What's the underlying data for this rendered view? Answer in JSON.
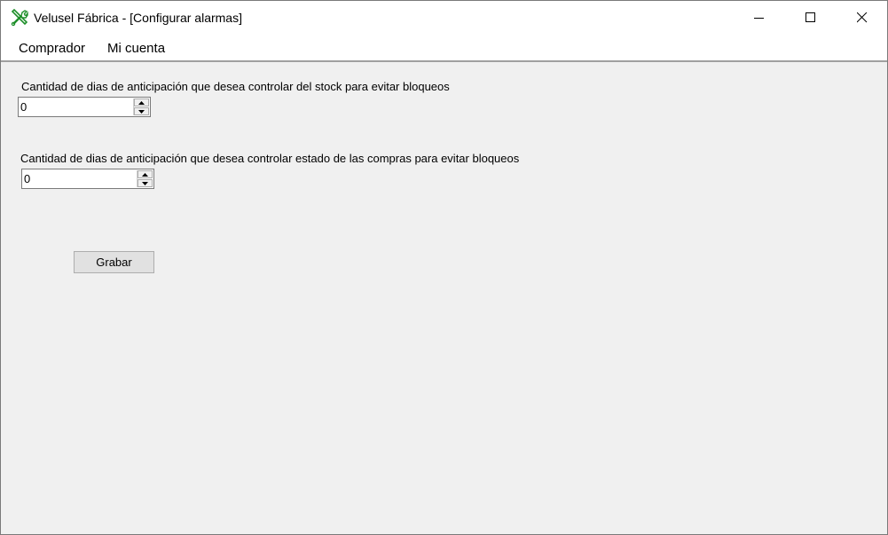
{
  "window": {
    "title": "Velusel Fábrica - [Configurar alarmas]",
    "icon": "tools-icon",
    "controls": [
      "minimize-icon",
      "maximize-icon",
      "close-icon"
    ]
  },
  "menu": {
    "items": [
      {
        "label": "Comprador"
      },
      {
        "label": "Mi cuenta"
      }
    ]
  },
  "form": {
    "stock_days": {
      "label": "Cantidad de dias de anticipación que desea controlar del stock para evitar bloqueos",
      "value": "0"
    },
    "purchase_days": {
      "label": "Cantidad de dias de anticipación que desea controlar estado de las compras para evitar bloqueos",
      "value": "0"
    },
    "save_label": "Grabar"
  },
  "colors": {
    "window_bg": "#f0f0f0",
    "icon_green": "#1e8f2a"
  }
}
